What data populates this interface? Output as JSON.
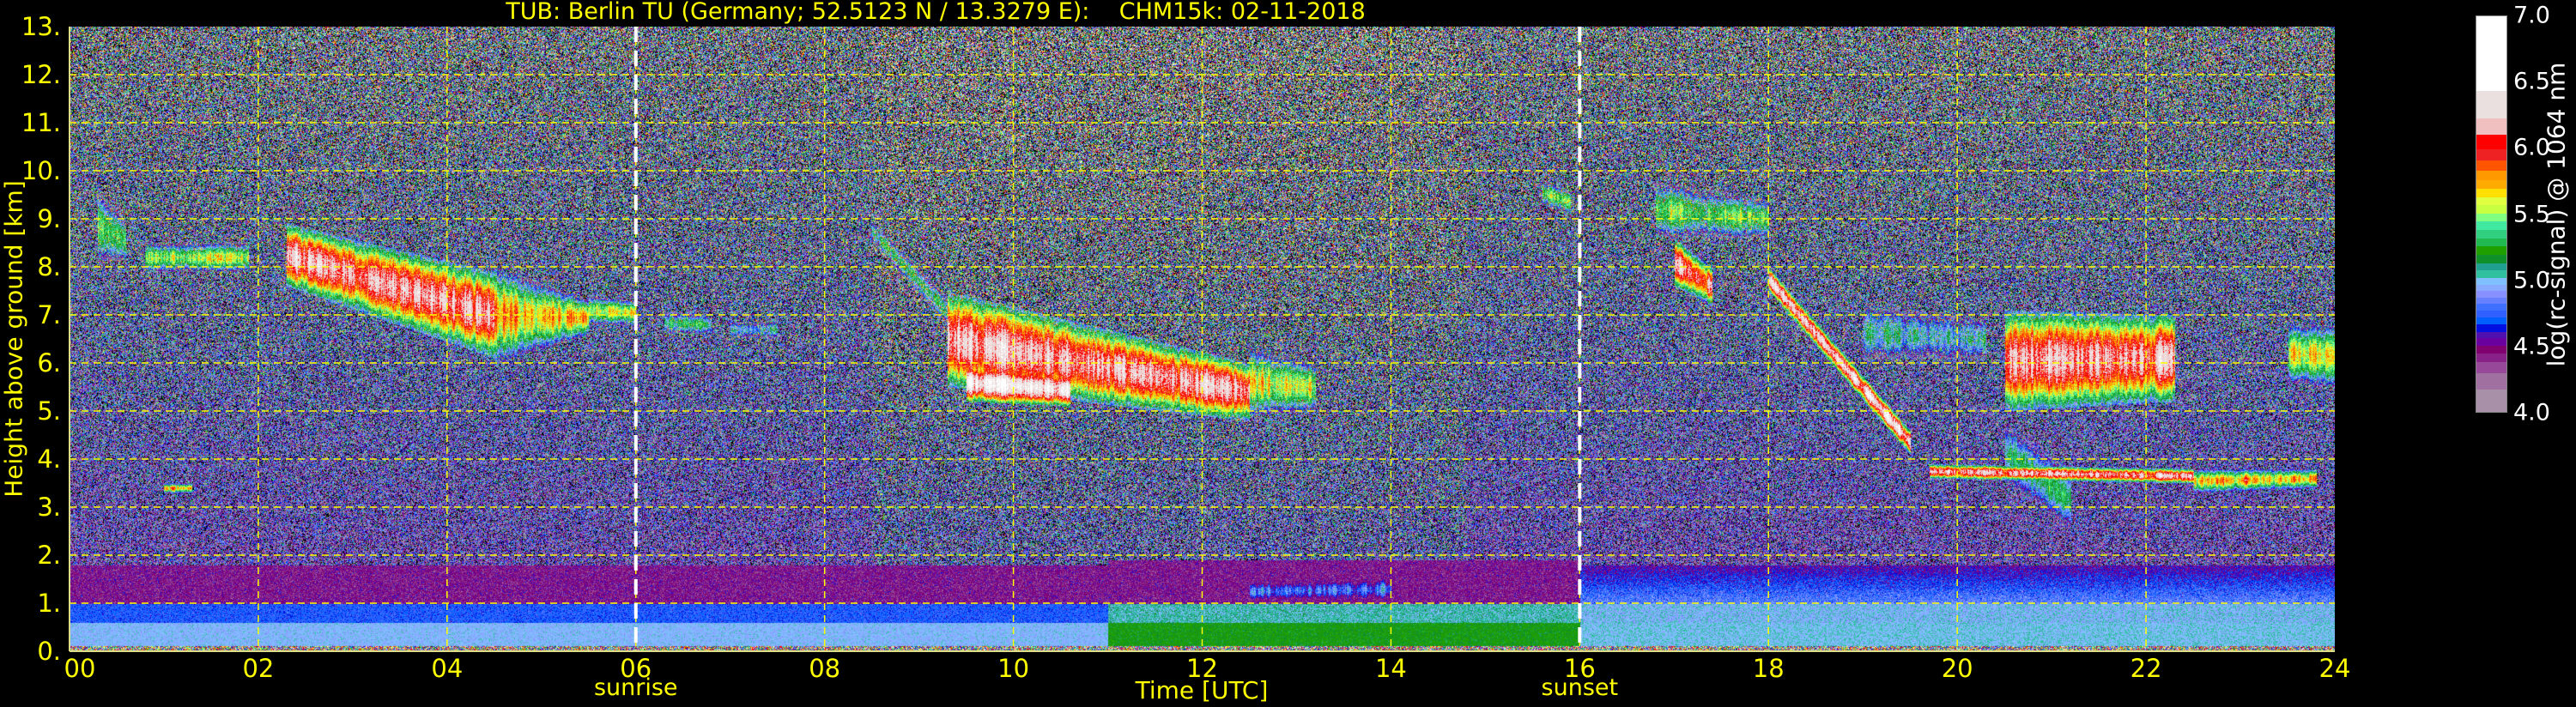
{
  "title": "TUB: Berlin TU (Germany; 52.5123 N / 13.3279 E):    CHM15k: 02-11-2018",
  "chart_data": {
    "type": "heatmap",
    "title": "TUB: Berlin TU (Germany; 52.5123 N / 13.3279 E):    CHM15k: 02-11-2018",
    "xlabel": "Time [UTC]",
    "ylabel": "Height above ground [km]",
    "xlim": [
      0,
      24
    ],
    "ylim": [
      0,
      13
    ],
    "x_ticks": [
      "00",
      "02",
      "04",
      "06",
      "08",
      "10",
      "12",
      "14",
      "16",
      "18",
      "20",
      "22",
      "24"
    ],
    "y_ticks": [
      "0.",
      "1.",
      "2.",
      "3.",
      "4.",
      "5.",
      "6.",
      "7.",
      "8.",
      "9.",
      "10.",
      "11.",
      "12.",
      "13."
    ],
    "grid": true,
    "grid_color": "#ffff00",
    "annotations": [
      {
        "label": "sunrise",
        "time": 6.0,
        "color": "#ffffff"
      },
      {
        "label": "sunset",
        "time": 16.0,
        "color": "#ffffff"
      }
    ],
    "colorbar": {
      "label": "log(rc-signal) @ 1064 nm",
      "range": [
        4.0,
        7.0
      ],
      "ticks": [
        "4.0",
        "4.5",
        "5.0",
        "5.5",
        "6.0",
        "6.5",
        "7.0"
      ],
      "bounds": [
        4.0,
        4.175,
        4.298,
        4.378,
        4.443,
        4.504,
        4.564,
        4.607,
        4.666,
        4.72,
        4.774,
        4.823,
        4.871,
        4.921,
        4.968,
        5.018,
        5.076,
        5.13,
        5.191,
        5.256,
        5.32,
        5.383,
        5.448,
        5.508,
        5.573,
        5.632,
        5.696,
        5.761,
        5.833,
        5.908,
        5.995,
        6.103,
        6.232,
        6.438,
        7.0
      ],
      "colors": [
        "#a890a8",
        "#a070a0",
        "#984898",
        "#882288",
        "#800070",
        "#6a00a0",
        "#5010b0",
        "#0010e0",
        "#0060ff",
        "#3060ff",
        "#4070ff",
        "#6680ff",
        "#8890ff",
        "#88aaff",
        "#80c0ff",
        "#30c0a0",
        "#20a090",
        "#10902a",
        "#20a000",
        "#20b850",
        "#30d080",
        "#40e8a0",
        "#80ff80",
        "#c8ff40",
        "#e0ff40",
        "#ffe000",
        "#ffaa00",
        "#ff9900",
        "#ff5500",
        "#ee2222",
        "#ff0000",
        "#f0c0c0",
        "#ebe0e0",
        "#ffffff"
      ],
      "under_color": "#000000"
    },
    "layers": [
      {
        "time_start": 0.3,
        "time_end": 0.6,
        "base_start": 8.1,
        "top_start": 9.6,
        "base_end": 8.1,
        "top_end": 9.0,
        "peak": 6.0
      },
      {
        "time_start": 0.8,
        "time_end": 1.9,
        "base_start": 7.9,
        "top_start": 8.5,
        "base_end": 7.9,
        "top_end": 8.5,
        "peak": 6.1
      },
      {
        "time_start": 2.3,
        "time_end": 4.5,
        "base_start": 7.6,
        "top_start": 8.9,
        "base_end": 6.1,
        "top_end": 7.9,
        "peak": 6.8
      },
      {
        "time_start": 4.5,
        "time_end": 5.5,
        "base_start": 6.0,
        "top_start": 8.0,
        "base_end": 6.6,
        "top_end": 7.3,
        "peak": 6.4
      },
      {
        "time_start": 5.5,
        "time_end": 6.0,
        "base_start": 6.8,
        "top_start": 7.4,
        "base_end": 6.8,
        "top_end": 7.3,
        "peak": 6.2
      },
      {
        "time_start": 6.3,
        "time_end": 6.8,
        "base_start": 6.6,
        "top_start": 7.1,
        "base_end": 6.6,
        "top_end": 7.0,
        "peak": 5.8
      },
      {
        "time_start": 7.0,
        "time_end": 7.5,
        "base_start": 6.5,
        "top_start": 6.9,
        "base_end": 6.5,
        "top_end": 6.9,
        "peak": 5.6
      },
      {
        "time_start": 8.5,
        "time_end": 9.5,
        "base_start": 8.5,
        "top_start": 9.0,
        "base_end": 6.3,
        "top_end": 7.0,
        "peak": 5.7
      },
      {
        "time_start": 9.3,
        "time_end": 12.5,
        "base_start": 5.5,
        "top_start": 7.5,
        "base_end": 4.8,
        "top_end": 6.0,
        "peak": 6.8
      },
      {
        "time_start": 9.5,
        "time_end": 10.6,
        "base_start": 5.2,
        "top_start": 6.0,
        "base_end": 5.1,
        "top_end": 5.8,
        "peak": 7.0
      },
      {
        "time_start": 12.5,
        "time_end": 13.2,
        "base_start": 4.9,
        "top_start": 6.3,
        "base_end": 5.0,
        "top_end": 6.0,
        "peak": 6.2
      },
      {
        "time_start": 15.6,
        "time_end": 15.9,
        "base_start": 9.3,
        "top_start": 9.8,
        "base_end": 9.1,
        "top_end": 9.6,
        "peak": 6.0
      },
      {
        "time_start": 16.8,
        "time_end": 18.0,
        "base_start": 8.6,
        "top_start": 9.8,
        "base_end": 8.6,
        "top_end": 9.4,
        "peak": 6.0
      },
      {
        "time_start": 17.0,
        "time_end": 17.4,
        "base_start": 7.6,
        "top_start": 8.6,
        "base_end": 7.2,
        "top_end": 8.0,
        "peak": 6.8
      },
      {
        "time_start": 18.0,
        "time_end": 19.5,
        "base_start": 7.5,
        "top_start": 8.0,
        "base_end": 4.1,
        "top_end": 4.6,
        "peak": 6.9
      },
      {
        "time_start": 19.0,
        "time_end": 20.3,
        "base_start": 6.0,
        "top_start": 7.3,
        "base_end": 6.0,
        "top_end": 7.0,
        "peak": 5.6
      },
      {
        "time_start": 19.7,
        "time_end": 22.5,
        "base_start": 3.6,
        "top_start": 3.9,
        "base_end": 3.5,
        "top_end": 3.8,
        "peak": 6.8
      },
      {
        "time_start": 20.5,
        "time_end": 22.3,
        "base_start": 5.0,
        "top_start": 7.1,
        "base_end": 5.2,
        "top_end": 7.0,
        "peak": 6.8
      },
      {
        "time_start": 20.5,
        "time_end": 21.2,
        "base_start": 3.5,
        "top_start": 4.8,
        "base_end": 2.5,
        "top_end": 3.8,
        "peak": 5.8
      },
      {
        "time_start": 22.5,
        "time_end": 23.8,
        "base_start": 3.3,
        "top_start": 3.8,
        "base_end": 3.4,
        "top_end": 3.8,
        "peak": 6.3
      },
      {
        "time_start": 23.5,
        "time_end": 24.0,
        "base_start": 5.6,
        "top_start": 6.8,
        "base_end": 5.5,
        "top_end": 6.8,
        "peak": 6.2
      },
      {
        "time_start": 1.0,
        "time_end": 1.3,
        "base_start": 3.3,
        "top_start": 3.5,
        "base_end": 3.3,
        "top_end": 3.5,
        "peak": 6.4
      },
      {
        "time_start": 12.5,
        "time_end": 14.0,
        "base_start": 1.0,
        "top_start": 1.5,
        "base_end": 1.0,
        "top_end": 1.6,
        "peak": 5.4
      },
      {
        "time_start": 11.5,
        "time_end": 16.0,
        "base_start": 0.3,
        "top_start": 1.0,
        "base_end": 0.3,
        "top_end": 1.0,
        "peak": 5.35
      }
    ]
  }
}
